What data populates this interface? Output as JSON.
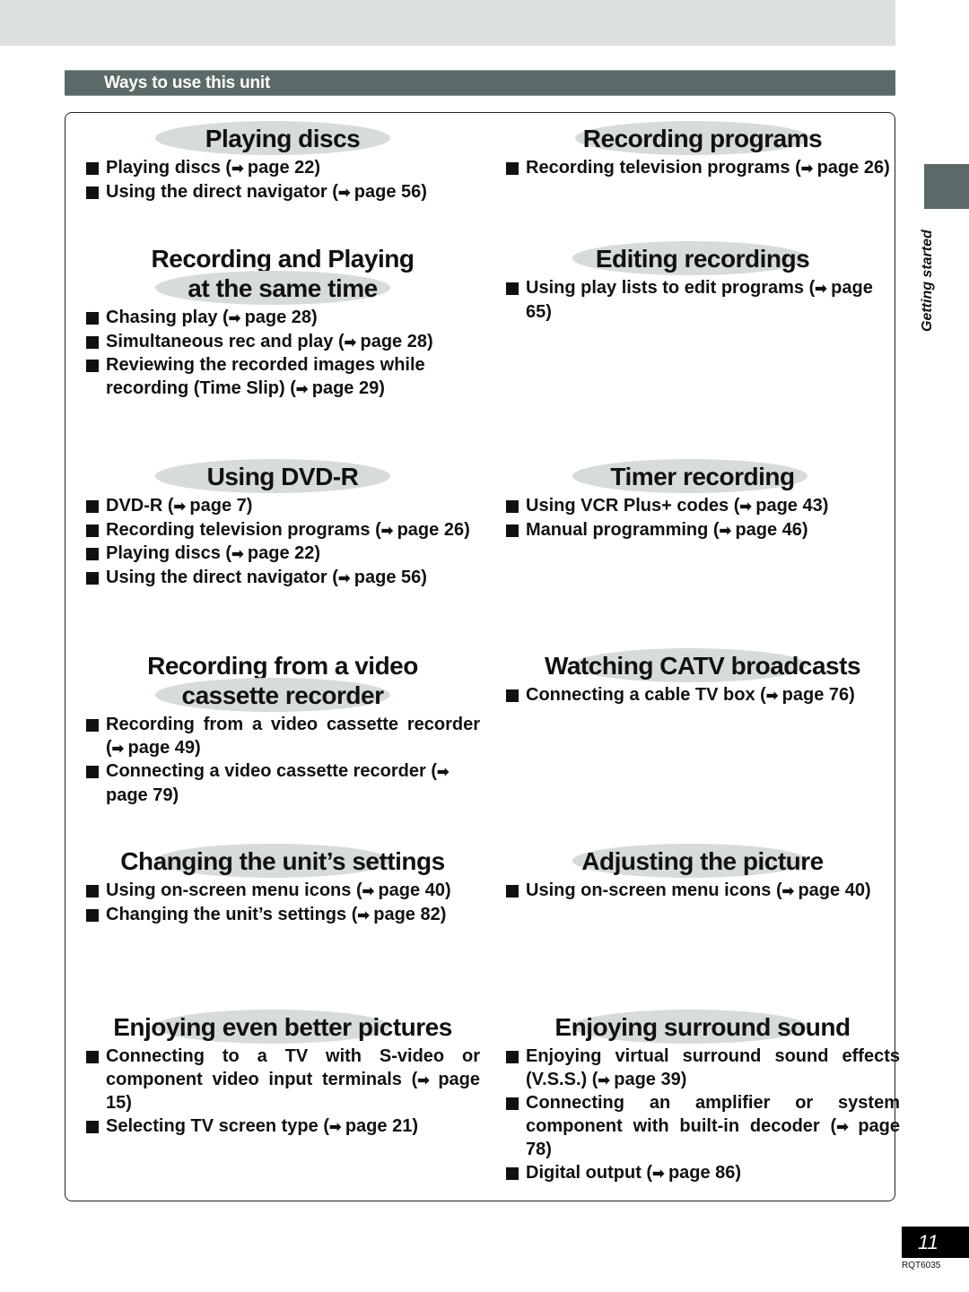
{
  "section_title": "Ways to use this unit",
  "side_label": "Getting started",
  "page_number": "11",
  "model_code": "RQT6035",
  "colors": {
    "bar": "#5b6968",
    "ellipse": "#d5dcd9",
    "band": "#dce1e0"
  },
  "blocks": [
    {
      "id": "playing-discs",
      "title": [
        "Playing discs"
      ],
      "items": [
        {
          "text": "Playing discs (",
          "page": "page 22)"
        },
        {
          "text": "Using the direct navigator (",
          "page": "page 56)"
        }
      ]
    },
    {
      "id": "recording-programs",
      "title": [
        "Recording programs"
      ],
      "items": [
        {
          "text": "Recording television programs (",
          "page": "page 26)"
        }
      ]
    },
    {
      "id": "recording-and-playing",
      "title": [
        "Recording and Playing",
        "at the same time"
      ],
      "items": [
        {
          "text": "Chasing play (",
          "page": "page 28)"
        },
        {
          "text": "Simultaneous rec and play (",
          "page": "page 28)"
        },
        {
          "text": "Reviewing the recorded images while recording (Time Slip) (",
          "page": "page 29)"
        }
      ]
    },
    {
      "id": "editing-recordings",
      "title": [
        "Editing recordings"
      ],
      "items": [
        {
          "text": "Using play lists to edit programs (",
          "page": "page 65)"
        }
      ]
    },
    {
      "id": "using-dvd-r",
      "title": [
        "Using DVD-R"
      ],
      "items": [
        {
          "text": "DVD-R (",
          "page": "page 7)"
        },
        {
          "text": "Recording television programs (",
          "page": "page 26)"
        },
        {
          "text": "Playing discs (",
          "page": "page 22)"
        },
        {
          "text": "Using the direct navigator (",
          "page": "page 56)"
        }
      ]
    },
    {
      "id": "timer-recording",
      "title": [
        "Timer recording"
      ],
      "items": [
        {
          "text": "Using VCR Plus+ codes (",
          "page": "page 43)"
        },
        {
          "text": "Manual programming (",
          "page": "page 46)"
        }
      ]
    },
    {
      "id": "recording-from-vcr",
      "title": [
        "Recording from a video",
        "cassette recorder"
      ],
      "items": [
        {
          "text": "Recording from a video cassette recorder (",
          "page": "page 49)"
        },
        {
          "text": "Connecting a video cassette recorder (",
          "page": "page 79)"
        }
      ]
    },
    {
      "id": "watching-catv",
      "title": [
        "Watching CATV broadcasts"
      ],
      "items": [
        {
          "text": "Connecting a cable TV box (",
          "page": "page 76)"
        }
      ]
    },
    {
      "id": "changing-settings",
      "title": [
        "Changing the unit’s settings"
      ],
      "items": [
        {
          "text": "Using on-screen menu icons (",
          "page": "page 40)"
        },
        {
          "text": "Changing the unit’s settings (",
          "page": "page 82)"
        }
      ]
    },
    {
      "id": "adjusting-picture",
      "title": [
        "Adjusting the picture"
      ],
      "items": [
        {
          "text": "Using on-screen menu icons (",
          "page": "page 40)"
        }
      ]
    },
    {
      "id": "better-pictures",
      "title": [
        "Enjoying even better pictures"
      ],
      "items": [
        {
          "text": "Connecting to a TV with S-video or component video input terminals (",
          "page": "page 15)"
        },
        {
          "text": "Selecting TV screen type (",
          "page": "page 21)"
        }
      ]
    },
    {
      "id": "surround-sound",
      "title": [
        "Enjoying surround sound"
      ],
      "items": [
        {
          "text": "Enjoying virtual surround sound effects (V.S.S.) (",
          "page": "page 39)"
        },
        {
          "text": "Connecting an amplifier or system component with built-in decoder (",
          "page": "page 78)"
        },
        {
          "text": "Digital output (",
          "page": "page 86)"
        }
      ]
    }
  ]
}
